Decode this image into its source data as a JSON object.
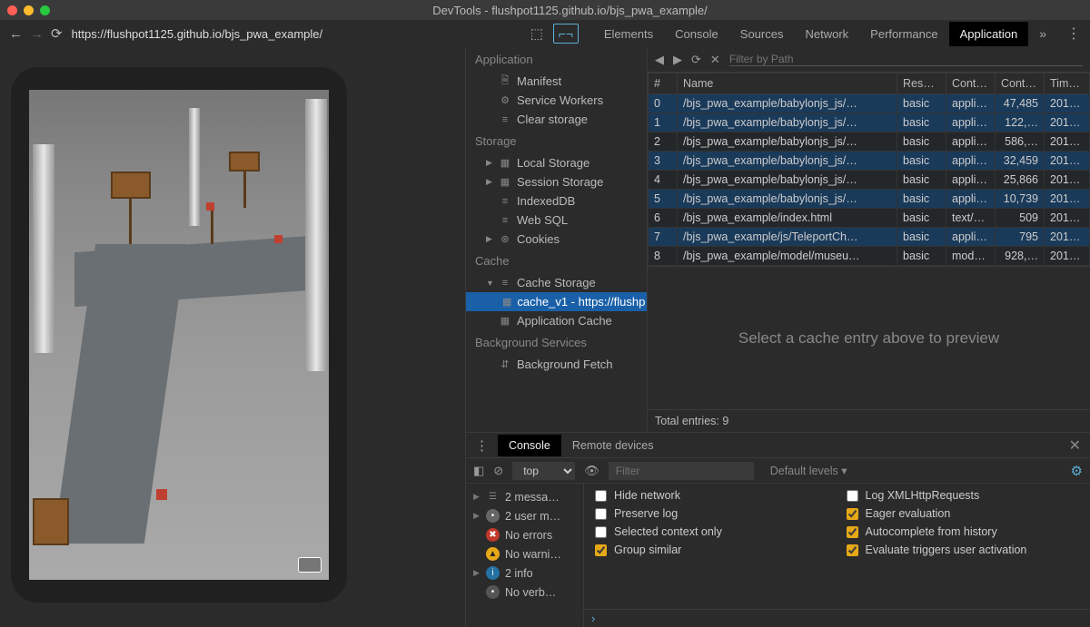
{
  "window": {
    "title": "DevTools - flushpot1125.github.io/bjs_pwa_example/"
  },
  "nav": {
    "url": "https://flushpot1125.github.io/bjs_pwa_example/"
  },
  "tabs": {
    "items": [
      "Elements",
      "Console",
      "Sources",
      "Network",
      "Performance",
      "Application"
    ],
    "active": "Application"
  },
  "sidebar": {
    "sections": [
      {
        "title": "Application",
        "items": [
          {
            "label": "Manifest",
            "icon": "doc"
          },
          {
            "label": "Service Workers",
            "icon": "gear"
          },
          {
            "label": "Clear storage",
            "icon": "db"
          }
        ]
      },
      {
        "title": "Storage",
        "items": [
          {
            "label": "Local Storage",
            "icon": "grid",
            "tri": true
          },
          {
            "label": "Session Storage",
            "icon": "grid",
            "tri": true
          },
          {
            "label": "IndexedDB",
            "icon": "db"
          },
          {
            "label": "Web SQL",
            "icon": "db"
          },
          {
            "label": "Cookies",
            "icon": "cookie",
            "tri": true
          }
        ]
      },
      {
        "title": "Cache",
        "items": [
          {
            "label": "Cache Storage",
            "icon": "db",
            "tri": true,
            "open": true,
            "children": [
              {
                "label": "cache_v1 - https://flushp",
                "icon": "grid",
                "active": true
              }
            ]
          },
          {
            "label": "Application Cache",
            "icon": "grid"
          }
        ]
      },
      {
        "title": "Background Services",
        "items": [
          {
            "label": "Background Fetch",
            "icon": "updown"
          }
        ]
      }
    ]
  },
  "cache": {
    "filter_placeholder": "Filter by Path",
    "headers": [
      "#",
      "Name",
      "Res…",
      "Cont…",
      "Cont…",
      "Time…"
    ],
    "rows": [
      {
        "n": 0,
        "name": "/bjs_pwa_example/babylonjs_js/…",
        "res": "basic",
        "ctype": "appli…",
        "clen": "47,485",
        "time": "2019…",
        "sel": true
      },
      {
        "n": 1,
        "name": "/bjs_pwa_example/babylonjs_js/…",
        "res": "basic",
        "ctype": "appli…",
        "clen": "122,…",
        "time": "2019…",
        "sel": true
      },
      {
        "n": 2,
        "name": "/bjs_pwa_example/babylonjs_js/…",
        "res": "basic",
        "ctype": "appli…",
        "clen": "586,…",
        "time": "2019…"
      },
      {
        "n": 3,
        "name": "/bjs_pwa_example/babylonjs_js/…",
        "res": "basic",
        "ctype": "appli…",
        "clen": "32,459",
        "time": "2019…",
        "sel": true
      },
      {
        "n": 4,
        "name": "/bjs_pwa_example/babylonjs_js/…",
        "res": "basic",
        "ctype": "appli…",
        "clen": "25,866",
        "time": "2019…"
      },
      {
        "n": 5,
        "name": "/bjs_pwa_example/babylonjs_js/…",
        "res": "basic",
        "ctype": "appli…",
        "clen": "10,739",
        "time": "2019…",
        "sel": true
      },
      {
        "n": 6,
        "name": "/bjs_pwa_example/index.html",
        "res": "basic",
        "ctype": "text/…",
        "clen": "509",
        "time": "2019…"
      },
      {
        "n": 7,
        "name": "/bjs_pwa_example/js/TeleportCh…",
        "res": "basic",
        "ctype": "appli…",
        "clen": "795",
        "time": "2019…",
        "sel": true
      },
      {
        "n": 8,
        "name": "/bjs_pwa_example/model/museu…",
        "res": "basic",
        "ctype": "mod…",
        "clen": "928,…",
        "time": "2019…"
      }
    ],
    "preview_msg": "Select a cache entry above to preview",
    "total": "Total entries: 9"
  },
  "drawer": {
    "tabs": [
      "Console",
      "Remote devices"
    ],
    "active": "Console",
    "context": "top",
    "filter_placeholder": "Filter",
    "levels": "Default levels ▾",
    "messages": [
      {
        "label": "2 messa…",
        "badge": "msg",
        "tri": true
      },
      {
        "label": "2 user m…",
        "badge": "user",
        "tri": true
      },
      {
        "label": "No errors",
        "badge": "err"
      },
      {
        "label": "No warni…",
        "badge": "warn"
      },
      {
        "label": "2 info",
        "badge": "info",
        "tri": true
      },
      {
        "label": "No verb…",
        "badge": "verb"
      }
    ],
    "settings": [
      {
        "label": "Hide network",
        "checked": false
      },
      {
        "label": "Log XMLHttpRequests",
        "checked": false
      },
      {
        "label": "Preserve log",
        "checked": false
      },
      {
        "label": "Eager evaluation",
        "checked": true
      },
      {
        "label": "Selected context only",
        "checked": false
      },
      {
        "label": "Autocomplete from history",
        "checked": true
      },
      {
        "label": "Group similar",
        "checked": true
      },
      {
        "label": "Evaluate triggers user activation",
        "checked": true
      }
    ]
  }
}
